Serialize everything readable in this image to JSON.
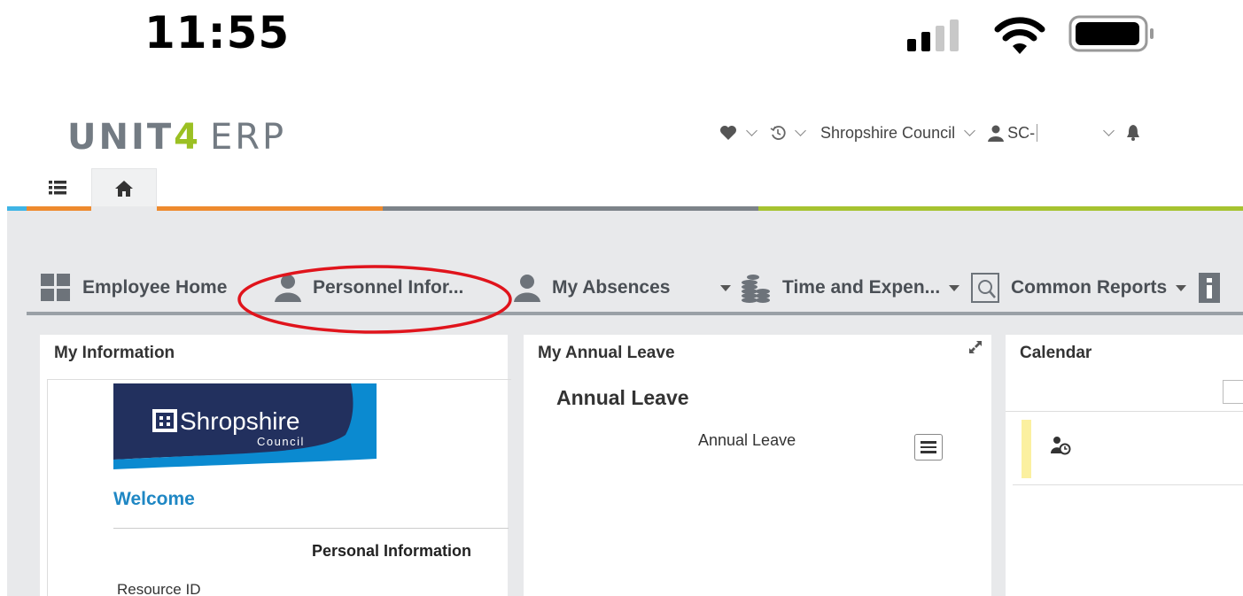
{
  "status_bar": {
    "time": "11:55",
    "icons": [
      "cellular-signal-icon",
      "wifi-icon",
      "battery-icon"
    ]
  },
  "app": {
    "logo": {
      "unit": "UNIT",
      "four": "4",
      "erp": "ERP"
    },
    "header": {
      "favorites_icon": "heart-icon",
      "history_icon": "history-icon",
      "company": "Shropshire Council",
      "user": "SC-",
      "notifications_icon": "bell-icon"
    },
    "tabs": [
      "list-icon",
      "home-icon"
    ]
  },
  "menu": {
    "items": [
      {
        "label": "Employee Home",
        "icon": "grid-icon"
      },
      {
        "label": "Personnel Infor...",
        "icon": "person-icon"
      },
      {
        "label": "My Absences",
        "icon": "person-icon"
      },
      {
        "label": "Time and Expen...",
        "icon": "coins-icon"
      },
      {
        "label": "Common Reports",
        "icon": "report-search-icon"
      }
    ],
    "more_icon": "info-icon"
  },
  "panels": {
    "my_information": {
      "title": "My Information",
      "banner_text": "Shropshire",
      "banner_subtext": "Council",
      "welcome": "Welcome",
      "section_heading": "Personal Information",
      "field_label": "Resource ID"
    },
    "my_annual_leave": {
      "title": "My Annual Leave",
      "heading": "Annual Leave",
      "chart_label": "Annual Leave"
    },
    "calendar": {
      "title": "Calendar"
    }
  },
  "colors": {
    "logo_grey": "#737b83",
    "logo_green": "#9bc023",
    "link_blue": "#1f87c4",
    "banner_navy": "#22305e",
    "annotation_red": "#e0141c"
  }
}
